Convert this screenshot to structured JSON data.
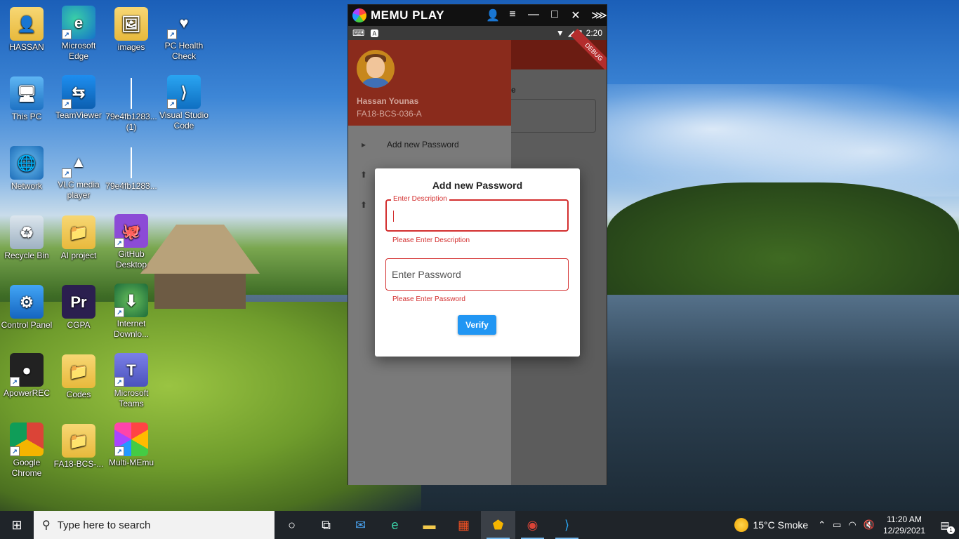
{
  "desktop": {
    "icons": [
      {
        "label": "HASSAN",
        "glyph": "👤"
      },
      {
        "label": "Microsoft Edge",
        "glyph": "e"
      },
      {
        "label": "images",
        "glyph": "🖼"
      },
      {
        "label": "PC Health Check",
        "glyph": "♥"
      },
      {
        "label": "This PC",
        "glyph": "🖥"
      },
      {
        "label": "TeamViewer",
        "glyph": "⇆"
      },
      {
        "label": "79e4fb1283... (1)",
        "glyph": ""
      },
      {
        "label": "Visual Studio Code",
        "glyph": "⟩"
      },
      {
        "label": "Network",
        "glyph": "🌐"
      },
      {
        "label": "VLC media player",
        "glyph": "▲"
      },
      {
        "label": "79e4fb1283...",
        "glyph": ""
      },
      {
        "label": "Recycle Bin",
        "glyph": "♻"
      },
      {
        "label": "AI project",
        "glyph": "📁"
      },
      {
        "label": "GitHub Desktop",
        "glyph": "🐙"
      },
      {
        "label": "Control Panel",
        "glyph": "⚙"
      },
      {
        "label": "CGPA",
        "glyph": "Pr"
      },
      {
        "label": "Internet Downlo...",
        "glyph": "⬇"
      },
      {
        "label": "ApowerREC",
        "glyph": "●"
      },
      {
        "label": "Codes",
        "glyph": "📁"
      },
      {
        "label": "Microsoft Teams",
        "glyph": "T"
      },
      {
        "label": "Google Chrome",
        "glyph": "●"
      },
      {
        "label": "FA18-BCS-...",
        "glyph": "📁"
      },
      {
        "label": "Multi-MEmu",
        "glyph": "◉"
      }
    ]
  },
  "memu": {
    "title": "MEMU PLAY",
    "controls": [
      "👤",
      "≡",
      "—",
      "□",
      "✕",
      "⋙"
    ]
  },
  "android": {
    "status_time": "2:20",
    "debug_label": "DEBUG",
    "bg_label": "e",
    "drawer": {
      "user_name": "Hassan Younas",
      "user_id": "FA18-BCS-036-A",
      "items": [
        {
          "label": "Add new Password",
          "icon": "▸"
        },
        {
          "label": "",
          "icon": "⬆"
        },
        {
          "label": "",
          "icon": "⬆"
        }
      ]
    },
    "dialog": {
      "title": "Add new Password",
      "description_label": "Enter Description",
      "description_value": "",
      "description_error": "Please Enter Description",
      "password_placeholder": "Enter Password",
      "password_error": "Please Enter Password",
      "verify_label": "Verify"
    }
  },
  "taskbar": {
    "search_placeholder": "Type here to search",
    "weather": "15°C  Smoke",
    "time": "11:20 AM",
    "date": "12/29/2021",
    "notification_count": "1"
  }
}
